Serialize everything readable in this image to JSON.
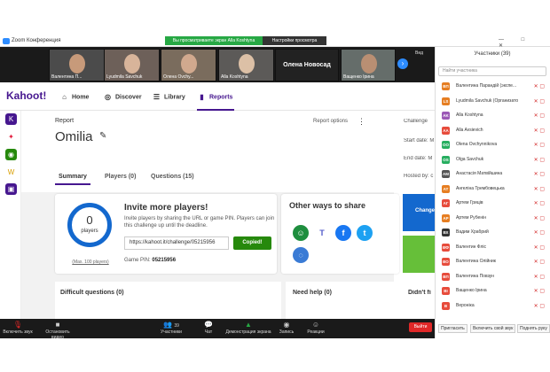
{
  "app": {
    "title": "Zoom Конференция"
  },
  "banner": {
    "viewing": "Вы просматриваете экран Alla Koshtyna",
    "view_options": "Настройки просмотра"
  },
  "window_controls": "— □ ✕",
  "gallery": {
    "tiles": [
      {
        "name": "Валентина П..."
      },
      {
        "name": "Lyudmila Savchuk"
      },
      {
        "name": "Олена Ovchy..."
      },
      {
        "name": "Alla Koshtyna"
      },
      {
        "name": "Олена Новосад"
      },
      {
        "name": "Ващенко Ірина"
      }
    ],
    "view_label": "Вид"
  },
  "kahoot": {
    "logo": "Kahoot!",
    "nav": {
      "home": "Home",
      "discover": "Discover",
      "library": "Library",
      "reports": "Reports"
    }
  },
  "report": {
    "label": "Report",
    "title": "Omilia",
    "options": "Report options",
    "tabs": {
      "summary": "Summary",
      "players": "Players (0)",
      "questions": "Questions (15)"
    }
  },
  "invite": {
    "count": "0",
    "count_label": "players",
    "max": "(Max. 100 players)",
    "title": "Invite more players!",
    "desc": "Invite players by sharing the URL or game PIN. Players can join this challenge up until the deadline.",
    "url": "https://kahoot.it/challenge/05215956",
    "copied": "Copied!",
    "pin_label": "Game PIN:",
    "pin": "05215956"
  },
  "share": {
    "title": "Other ways to share",
    "icons": [
      "classroom-icon",
      "teams-icon",
      "facebook-icon",
      "twitter-icon",
      "remind-icon"
    ]
  },
  "info": {
    "challenge": "Challenge",
    "start": "Start date: M",
    "end": "End date: M",
    "hosted": "Hosted by: c",
    "blue_btn": "Change"
  },
  "cards": {
    "difficult": "Difficult questions (0)",
    "help": "Need help (0)",
    "didnt": "Didn't fi"
  },
  "participants": {
    "title": "Участники (39)",
    "search_placeholder": "Найти участника",
    "list": [
      {
        "initials": "ВП",
        "name": "Валентина Парандій (экспе...",
        "color": "#e67e22"
      },
      {
        "initials": "LS",
        "name": "Lyudmila Savchuk (Организатор)",
        "color": "#e67e22"
      },
      {
        "initials": "AK",
        "name": "Alla Koshtyna",
        "color": "#9b59b6"
      },
      {
        "initials": "AA",
        "name": "Alla Avsievich",
        "color": "#e74c3c"
      },
      {
        "initials": "OO",
        "name": "Olena Ovchynnikova",
        "color": "#27ae60"
      },
      {
        "initials": "OS",
        "name": "Olga Savchuk",
        "color": "#27ae60"
      },
      {
        "initials": "AM",
        "name": "Анастасія Матвійшина",
        "color": "#555"
      },
      {
        "initials": "AT",
        "name": "Ангеліна Трембовецька",
        "color": "#e67e22"
      },
      {
        "initials": "AГ",
        "name": "Артем Гриців",
        "color": "#e74c3c"
      },
      {
        "initials": "AP",
        "name": "Артем Рубенін",
        "color": "#e67e22"
      },
      {
        "initials": "ВХ",
        "name": "Вадим Храбрий",
        "color": "#333"
      },
      {
        "initials": "ВФ",
        "name": "Валентин Фліс",
        "color": "#e74c3c"
      },
      {
        "initials": "ВО",
        "name": "Валентина Олійник",
        "color": "#e74c3c"
      },
      {
        "initials": "ВП",
        "name": "Валентина Повзун",
        "color": "#e74c3c"
      },
      {
        "initials": "ВІ",
        "name": "Ващенко Ірина",
        "color": "#e74c3c"
      },
      {
        "initials": "В",
        "name": "Вероніка",
        "color": "#e74c3c"
      }
    ],
    "invite": "Пригласить",
    "unmute": "Включить свой звук",
    "raise": "Поднять руку"
  },
  "toolbar": {
    "mic": "Включить звук",
    "video": "Остановить видео",
    "participants": "Участники",
    "participants_count": "39",
    "chat": "Чат",
    "share": "Демонстрация экрана",
    "record": "Запись",
    "reactions": "Реакции",
    "end": "Выйти"
  }
}
